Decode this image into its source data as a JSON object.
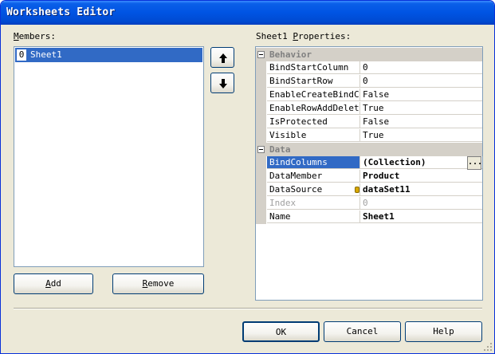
{
  "window": {
    "title": "Worksheets Editor"
  },
  "members": {
    "label": "Members:",
    "items": [
      {
        "index": "0",
        "name": "Sheet1"
      }
    ],
    "add_label": "Add",
    "remove_label": "Remove"
  },
  "properties": {
    "label": "Sheet1 Properties:",
    "categories": [
      {
        "name": "Behavior",
        "rows": [
          {
            "name": "BindStartColumn",
            "value": "0"
          },
          {
            "name": "BindStartRow",
            "value": "0"
          },
          {
            "name": "EnableCreateBindCol",
            "value": "False"
          },
          {
            "name": "EnableRowAddDelete",
            "value": "True"
          },
          {
            "name": "IsProtected",
            "value": "False"
          },
          {
            "name": "Visible",
            "value": "True"
          }
        ]
      },
      {
        "name": "Data",
        "rows": [
          {
            "name": "BindColumns",
            "value": "(Collection)"
          },
          {
            "name": "DataMember",
            "value": "Product"
          },
          {
            "name": "DataSource",
            "value": "dataSet11"
          },
          {
            "name": "Index",
            "value": "0"
          },
          {
            "name": "Name",
            "value": "Sheet1"
          }
        ]
      }
    ],
    "ellipsis": "..."
  },
  "footer": {
    "ok": "OK",
    "cancel": "Cancel",
    "help": "Help"
  }
}
